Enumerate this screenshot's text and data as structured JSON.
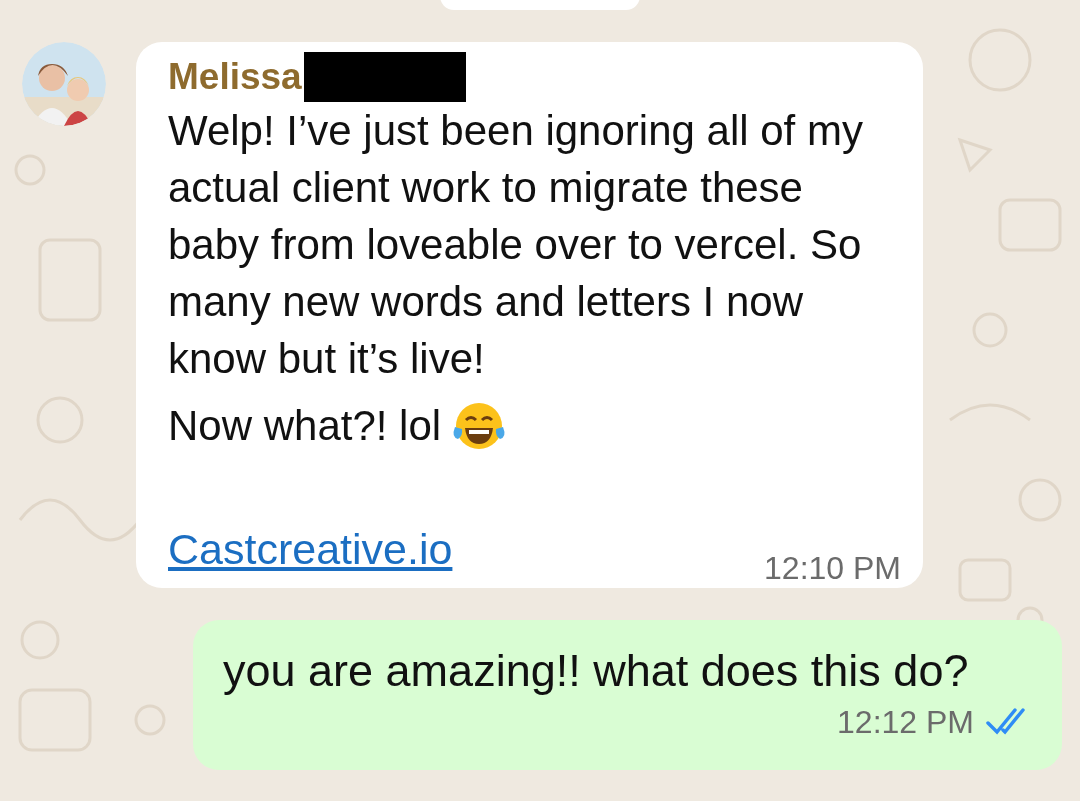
{
  "messages": [
    {
      "kind": "incoming",
      "sender": "Melissa",
      "sender_redacted": true,
      "paragraphs": [
        "Welp! I’ve just been ignoring all of my actual client work to migrate these baby from loveable over to vercel. So many new words and letters I now know but it’s live!",
        "Now what?! lol"
      ],
      "link": "Castcreative.io",
      "time": "12:10 PM"
    },
    {
      "kind": "outgoing",
      "text": "you are amazing!! what does this do?",
      "time": "12:12 PM",
      "read": true
    }
  ]
}
